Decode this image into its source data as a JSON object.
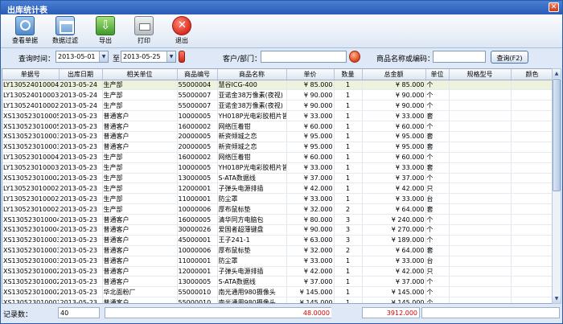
{
  "window": {
    "title": "出库统计表"
  },
  "toolbar": [
    {
      "name": "view-report-button",
      "label": "查看单据",
      "icon": "search-icon"
    },
    {
      "name": "data-filter-button",
      "label": "数据过滤",
      "icon": "filter-icon"
    },
    {
      "name": "export-button",
      "label": "导出",
      "icon": "export-icon"
    },
    {
      "name": "print-button",
      "label": "打印",
      "icon": "printer-icon"
    },
    {
      "name": "exit-button",
      "label": "退出",
      "icon": "exit-icon"
    }
  ],
  "filters": {
    "time_label": "查询时间：",
    "date_from": "2013-05-01",
    "to_label": "至",
    "date_to": "2013-05-25",
    "customer_label": "客户/部门：",
    "customer_value": "",
    "product_label": "商品名称或编码：",
    "product_value": "",
    "query_button": "查询(F2)"
  },
  "columns": [
    "单据号",
    "出库日期",
    "相关单位",
    "商品编号",
    "商品名称",
    "单价",
    "数量",
    "总金额",
    "单位",
    "规格型号",
    "颜色"
  ],
  "rows": [
    [
      "LY130524010004",
      "2013-05-24",
      "生产部",
      "55000004",
      "慧谷ICG-400",
      "¥ 85.000",
      "1",
      "¥ 85.000",
      "个",
      "",
      ""
    ],
    [
      "LY130524010003",
      "2013-05-24",
      "生产部",
      "55000007",
      "亚诺金38万像素(夜视)",
      "¥ 90.000",
      "1",
      "¥ 90.000",
      "个",
      "",
      ""
    ],
    [
      "LY130524010002",
      "2013-05-24",
      "生产部",
      "55000007",
      "亚诺金38万像素(夜视)",
      "¥ 90.000",
      "1",
      "¥ 90.000",
      "个",
      "",
      ""
    ],
    [
      "XS130523010005",
      "2013-05-23",
      "普通客户",
      "10000005",
      "YH018P光电彩胶相片皆",
      "¥ 33.000",
      "1",
      "¥ 33.000",
      "套",
      "",
      ""
    ],
    [
      "XS130523010005",
      "2013-05-23",
      "普通客户",
      "16000002",
      "网络压着钳",
      "¥ 60.000",
      "1",
      "¥ 60.000",
      "个",
      "",
      ""
    ],
    [
      "XS130523010003",
      "2013-05-23",
      "普通客户",
      "20000005",
      "新资倾城之恋",
      "¥ 95.000",
      "1",
      "¥ 95.000",
      "套",
      "",
      ""
    ],
    [
      "XS130523010003",
      "2013-05-23",
      "普通客户",
      "20000005",
      "新资倾城之恋",
      "¥ 95.000",
      "1",
      "¥ 95.000",
      "套",
      "",
      ""
    ],
    [
      "LY130523010004",
      "2013-05-23",
      "生产部",
      "16000002",
      "网络压着钳",
      "¥ 60.000",
      "1",
      "¥ 60.000",
      "个",
      "",
      ""
    ],
    [
      "LY130523010003",
      "2013-05-23",
      "生产部",
      "10000005",
      "YH018P光电彩胶相片皆",
      "¥ 33.000",
      "1",
      "¥ 33.000",
      "套",
      "",
      ""
    ],
    [
      "XS130523010002",
      "2013-05-23",
      "生产部",
      "13000005",
      "S-ATA数据线",
      "¥ 37.000",
      "1",
      "¥ 37.000",
      "个",
      "",
      ""
    ],
    [
      "LY130523010002",
      "2013-05-23",
      "生产部",
      "12000001",
      "子弹头电源排插",
      "¥ 42.000",
      "1",
      "¥ 42.000",
      "只",
      "",
      ""
    ],
    [
      "LY130523010002",
      "2013-05-23",
      "生产部",
      "11000001",
      "防尘罩",
      "¥ 33.000",
      "1",
      "¥ 33.000",
      "台",
      "",
      ""
    ],
    [
      "LY130523010002",
      "2013-05-23",
      "生产部",
      "10000006",
      "厚布鼠标垫",
      "¥ 32.000",
      "2",
      "¥ 64.000",
      "套",
      "",
      ""
    ],
    [
      "XS130523010004",
      "2013-05-23",
      "普通客户",
      "16000005",
      "清华同方电脑包",
      "¥ 80.000",
      "3",
      "¥ 240.000",
      "个",
      "",
      ""
    ],
    [
      "XS130523010004",
      "2013-05-23",
      "普通客户",
      "30000026",
      "爱国者超薄键盘",
      "¥ 90.000",
      "3",
      "¥ 270.000",
      "个",
      "",
      ""
    ],
    [
      "XS130523010003",
      "2013-05-23",
      "普通客户",
      "45000001",
      "王子241-1",
      "¥ 63.000",
      "3",
      "¥ 189.000",
      "个",
      "",
      ""
    ],
    [
      "XS130523010003",
      "2013-05-23",
      "普通客户",
      "10000006",
      "厚布鼠标垫",
      "¥ 32.000",
      "2",
      "¥ 64.000",
      "套",
      "",
      ""
    ],
    [
      "XS130523010003",
      "2013-05-23",
      "普通客户",
      "11000001",
      "防尘罩",
      "¥ 33.000",
      "1",
      "¥ 33.000",
      "台",
      "",
      ""
    ],
    [
      "XS130523010002",
      "2013-05-23",
      "普通客户",
      "12000001",
      "子弹头电源排插",
      "¥ 42.000",
      "1",
      "¥ 42.000",
      "只",
      "",
      ""
    ],
    [
      "XS130523010002",
      "2013-05-23",
      "普通客户",
      "13000005",
      "S-ATA数据线",
      "¥ 37.000",
      "1",
      "¥ 37.000",
      "个",
      "",
      ""
    ],
    [
      "XS130523010002",
      "2013-05-23",
      "华北面粉厂",
      "55000010",
      "南光通用980摄像头",
      "¥ 145.000",
      "1",
      "¥ 145.000",
      "个",
      "",
      ""
    ],
    [
      "XS130523010001",
      "2013-05-23",
      "普通客户",
      "55000010",
      "南光通用980摄像头",
      "¥ 145.000",
      "1",
      "¥ 145.000",
      "个",
      "",
      ""
    ]
  ],
  "footer": {
    "count_label": "记录数：",
    "count_value": "40",
    "total_qty": "48.0000",
    "total_amount": "3912.000"
  }
}
